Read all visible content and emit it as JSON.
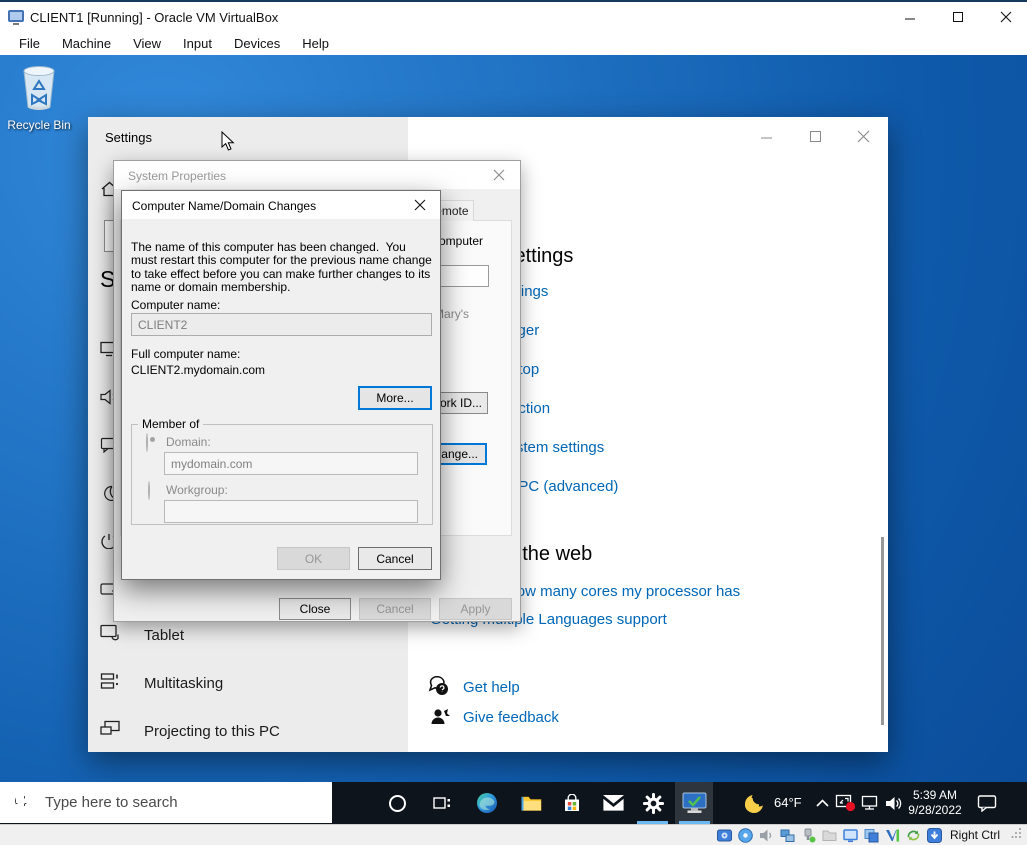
{
  "vbox": {
    "title": "CLIENT1 [Running] - Oracle VM VirtualBox",
    "menu": [
      "File",
      "Machine",
      "View",
      "Input",
      "Devices",
      "Help"
    ],
    "status": {
      "host_key": "Right Ctrl",
      "icons": [
        "hard-disks",
        "optical-drives",
        "audio",
        "network-adapters",
        "usb-devices",
        "shared-folders",
        "display",
        "recording",
        "vm-features",
        "shared-clipboard",
        "keyboard-capture"
      ]
    }
  },
  "desktop": {
    "recycle_bin_label": "Recycle Bin"
  },
  "taskbar": {
    "search_placeholder": "Type here to search",
    "temperature": "64°F",
    "time": "5:39 AM",
    "date": "9/28/2022"
  },
  "settings": {
    "title": "Settings",
    "sidebar": {
      "heading": "System",
      "items": [
        "Tablet",
        "Multitasking",
        "Projecting to this PC"
      ]
    },
    "related": {
      "heading": "Related settings",
      "links": [
        "BitLocker settings",
        "Device Manager",
        "Remote desktop",
        "System protection",
        "Advanced system settings",
        "Rename this PC (advanced)"
      ]
    },
    "help_web": {
      "heading": "Help from the web",
      "links": [
        "Finding out how many cores my processor has",
        "Getting multiple Languages support"
      ]
    },
    "get_help": "Get help",
    "give_feedback": "Give feedback"
  },
  "system_properties": {
    "title": "System Properties",
    "tab": "Remote",
    "identify_fragment": "to identify your computer",
    "marys_fragment": "\"Mary's",
    "network_id_button": "Network ID...",
    "change_button": "Change...",
    "close_button": "Close",
    "cancel_button": "Cancel",
    "apply_button": "Apply"
  },
  "name_dialog": {
    "title": "Computer Name/Domain Changes",
    "message": "The name of this computer has been changed.  You must restart this computer for the previous name change to take effect before you can make further changes to its name or domain membership.",
    "computer_name_label": "Computer name:",
    "computer_name_value": "CLIENT2",
    "full_name_label": "Full computer name:",
    "full_name_value": "CLIENT2.mydomain.com",
    "more_button": "More...",
    "member_of": "Member of",
    "domain_label": "Domain:",
    "domain_value": "mydomain.com",
    "workgroup_label": "Workgroup:",
    "ok_button": "OK",
    "cancel_button": "Cancel"
  }
}
